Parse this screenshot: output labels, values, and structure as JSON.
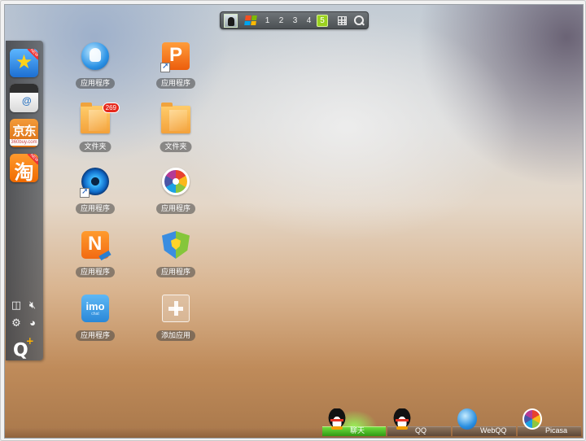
{
  "topbar": {
    "pages": [
      "1",
      "2",
      "3",
      "4",
      "5"
    ],
    "active_page": "5"
  },
  "colors": {
    "accent_green": "#9bd21f",
    "badge_red": "#e5291c",
    "win_logo": [
      "#f25022",
      "#7fba00",
      "#00a4ef",
      "#ffb900"
    ]
  },
  "dock": {
    "apps": [
      {
        "icon": "star-app-icon",
        "glyph": "★",
        "tag": "NEW"
      },
      {
        "icon": "mail-app-icon",
        "glyph": "@"
      },
      {
        "icon": "jingdong-app-icon",
        "glyph": "京东",
        "sub": "360buy.com"
      },
      {
        "icon": "taobao-app-icon",
        "glyph": "淘",
        "tag": "NEW"
      }
    ],
    "tools": [
      "layout-icon",
      "volume-mute-icon",
      "settings-gear-icon",
      "theme-palette-icon"
    ],
    "qplus_label": "Q",
    "qplus_sup": "+"
  },
  "desktop": {
    "icons": [
      {
        "label": "应用程序",
        "icon": "qq-blue-app-icon"
      },
      {
        "label": "应用程序",
        "icon": "p-app-icon",
        "glyph": "P"
      },
      {
        "label": "文件夹",
        "icon": "folder-icon",
        "badge": "269"
      },
      {
        "label": "文件夹",
        "icon": "folder-icon"
      },
      {
        "label": "应用程序",
        "icon": "camera-app-icon"
      },
      {
        "label": "应用程序",
        "icon": "picasa-app-icon"
      },
      {
        "label": "应用程序",
        "icon": "n-app-icon",
        "glyph": "N"
      },
      {
        "label": "应用程序",
        "icon": "shield-app-icon"
      },
      {
        "label": "应用程序",
        "icon": "imo-app-icon",
        "glyph": "imo",
        "sub": "chat"
      },
      {
        "label": "添加应用",
        "icon": "add-app-icon"
      }
    ]
  },
  "taskbar": {
    "items": [
      {
        "label": "聊天",
        "icon": "qq-penguin-icon",
        "active": true
      },
      {
        "label": "QQ",
        "icon": "qq-penguin-icon",
        "active": false
      },
      {
        "label": "WebQQ",
        "icon": "webqq-icon",
        "active": false
      },
      {
        "label": "Picasa",
        "icon": "picasa-icon",
        "active": false
      }
    ]
  }
}
